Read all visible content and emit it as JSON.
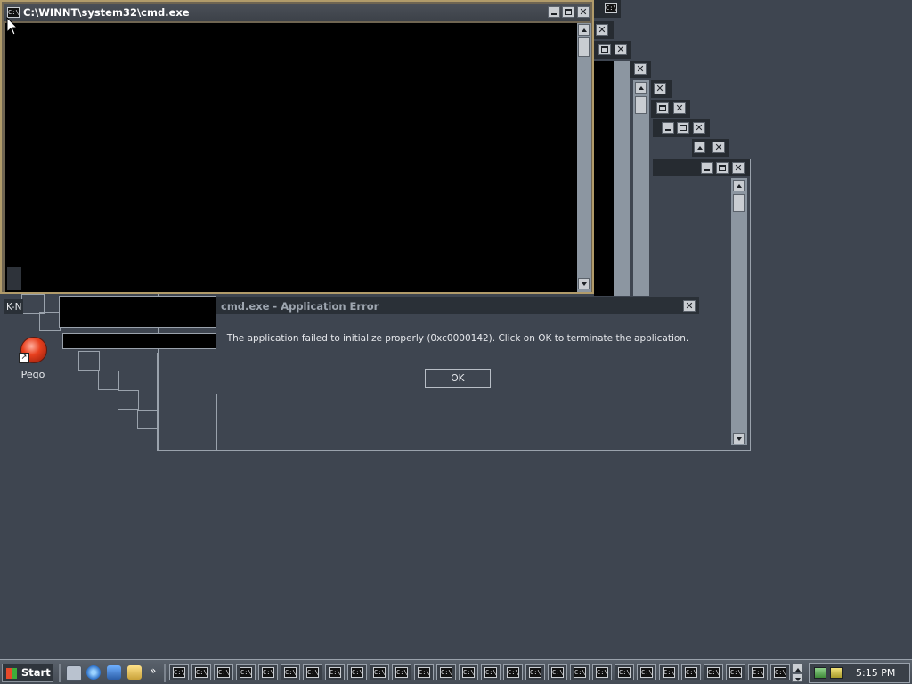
{
  "cmd_window": {
    "title": "C:\\WINNT\\system32\\cmd.exe",
    "icon_text": "C:\\"
  },
  "background_windows": {
    "partial_label": "K-N"
  },
  "error_dialog": {
    "title": "cmd.exe - Application Error",
    "message": "The application failed to initialize properly (0xc0000142). Click on OK to terminate the application.",
    "ok_label": "OK"
  },
  "desktop": {
    "icons": [
      {
        "label": "Pego",
        "icon": "pego-ball-icon"
      }
    ]
  },
  "taskbar": {
    "start_label": "Start",
    "quick_launch": [
      "show-desktop-icon",
      "internet-explorer-icon",
      "outlook-express-icon",
      "windows-explorer-icon"
    ],
    "overflow_label": "»",
    "task_icon_text": "C:\\",
    "task_count": 28,
    "clock": "5:15 PM"
  }
}
